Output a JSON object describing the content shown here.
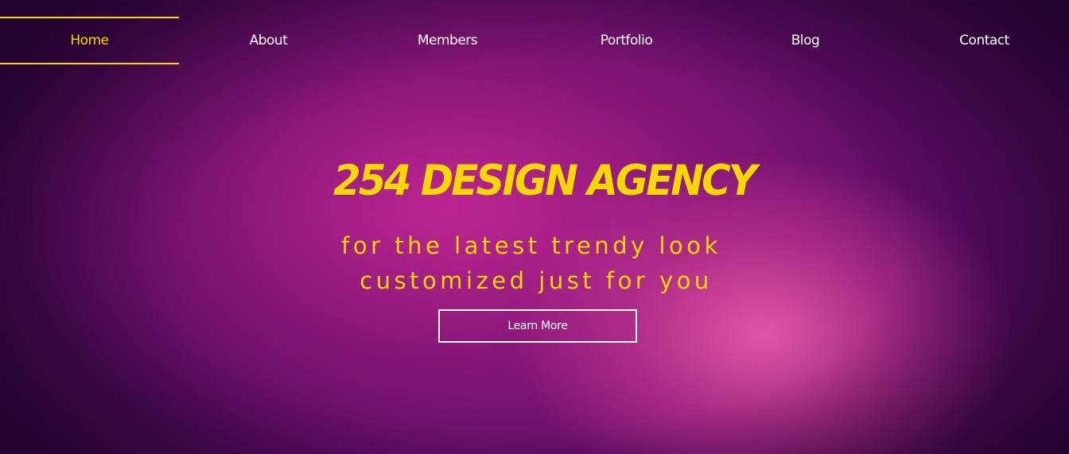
{
  "nav": {
    "items": [
      {
        "label": "Home",
        "active": true
      },
      {
        "label": "About",
        "active": false
      },
      {
        "label": "Members",
        "active": false
      },
      {
        "label": "Portfolio",
        "active": false
      },
      {
        "label": "Blog",
        "active": false
      },
      {
        "label": "Contact",
        "active": false
      }
    ]
  },
  "hero": {
    "title": "254 DESIGN AGENCY",
    "tagline_line1": "for the latest trendy look",
    "tagline_line2": "customized just for you",
    "cta_label": "Learn More"
  },
  "colors": {
    "accent": "#f5d800",
    "text_light": "#ffffff",
    "background_dark": "#2a0538",
    "background_mid": "#8a1a7e",
    "background_highlight": "#e65aaa"
  }
}
